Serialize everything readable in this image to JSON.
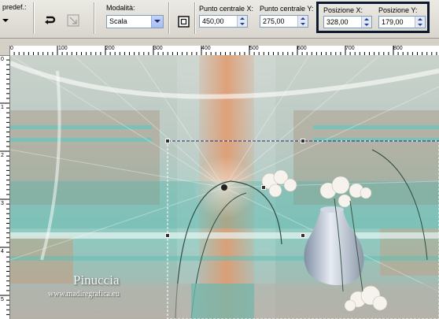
{
  "toolbar": {
    "presets_label": "predef.:",
    "mode_label": "Modalità:",
    "mode_value": "Scala",
    "center_x_label": "Punto centrale X:",
    "center_x_value": "450,00",
    "center_y_label": "Punto centrale Y:",
    "center_y_value": "275,00",
    "pos_x_label": "Posizione X:",
    "pos_x_value": "328,00",
    "pos_y_label": "Posizione Y:",
    "pos_y_value": "179,00"
  },
  "ruler": {
    "top_ticks": [
      "0",
      "100",
      "200",
      "300",
      "400",
      "500",
      "600",
      "700",
      "800"
    ],
    "left_ticks": [
      "0",
      "1",
      "2",
      "3",
      "4",
      "5"
    ]
  },
  "watermark": {
    "name": "Pinuccia",
    "site": "www.madiregrafica.eu"
  },
  "colors": {
    "highlight_border": "#0b1a2e",
    "toolbar_bg": "#d4d0c8",
    "canvas_teal": "#6fc0b8",
    "canvas_orange": "#d7875a"
  },
  "icons": [
    "chevron-down-icon",
    "reset-transform-icon",
    "pick-tool-icon",
    "spin-icon",
    "dropdown-icon"
  ]
}
